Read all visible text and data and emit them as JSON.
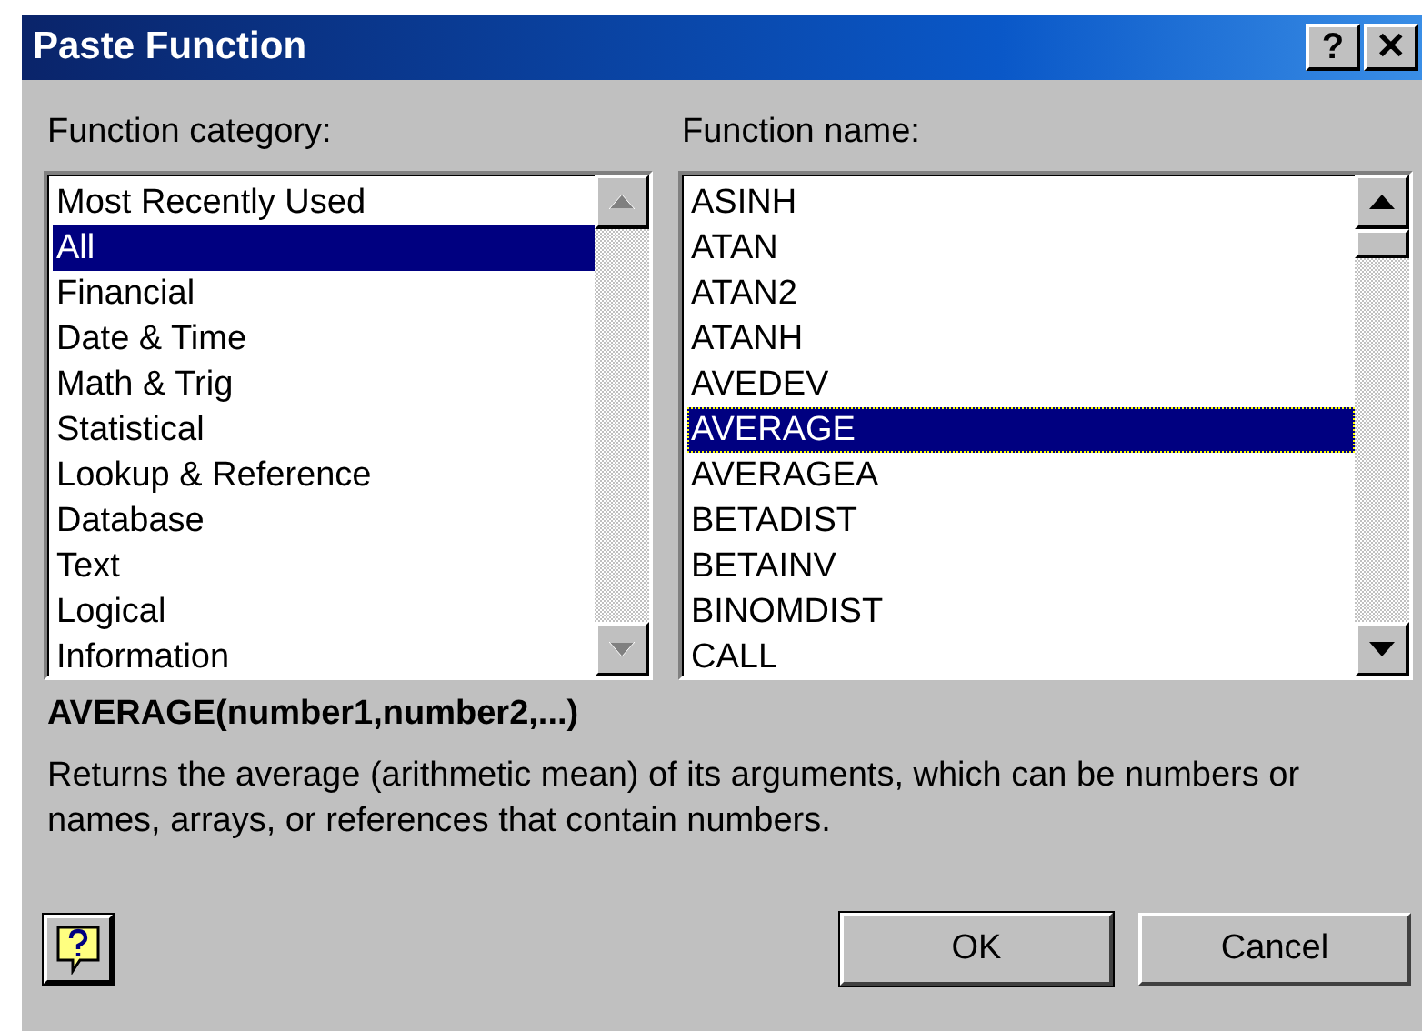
{
  "window": {
    "title": "Paste Function",
    "help_button": "?",
    "close_button": "✕"
  },
  "category_list": {
    "label": "Function category:",
    "scroll_disabled": true,
    "items": [
      {
        "label": "Most Recently Used",
        "selected": false
      },
      {
        "label": "All",
        "selected": true
      },
      {
        "label": "Financial",
        "selected": false
      },
      {
        "label": "Date & Time",
        "selected": false
      },
      {
        "label": "Math & Trig",
        "selected": false
      },
      {
        "label": "Statistical",
        "selected": false
      },
      {
        "label": "Lookup & Reference",
        "selected": false
      },
      {
        "label": "Database",
        "selected": false
      },
      {
        "label": "Text",
        "selected": false
      },
      {
        "label": "Logical",
        "selected": false
      },
      {
        "label": "Information",
        "selected": false
      }
    ]
  },
  "name_list": {
    "label": "Function name:",
    "scroll_disabled": false,
    "items": [
      {
        "label": "ASINH",
        "selected": false
      },
      {
        "label": "ATAN",
        "selected": false
      },
      {
        "label": "ATAN2",
        "selected": false
      },
      {
        "label": "ATANH",
        "selected": false
      },
      {
        "label": "AVEDEV",
        "selected": false
      },
      {
        "label": "AVERAGE",
        "selected": true
      },
      {
        "label": "AVERAGEA",
        "selected": false
      },
      {
        "label": "BETADIST",
        "selected": false
      },
      {
        "label": "BETAINV",
        "selected": false
      },
      {
        "label": "BINOMDIST",
        "selected": false
      },
      {
        "label": "CALL",
        "selected": false
      }
    ]
  },
  "syntax": "AVERAGE(number1,number2,...)",
  "description": "Returns the average (arithmetic mean) of its arguments, which can be numbers or names, arrays, or references that contain numbers.",
  "buttons": [
    "OK",
    "Cancel"
  ]
}
